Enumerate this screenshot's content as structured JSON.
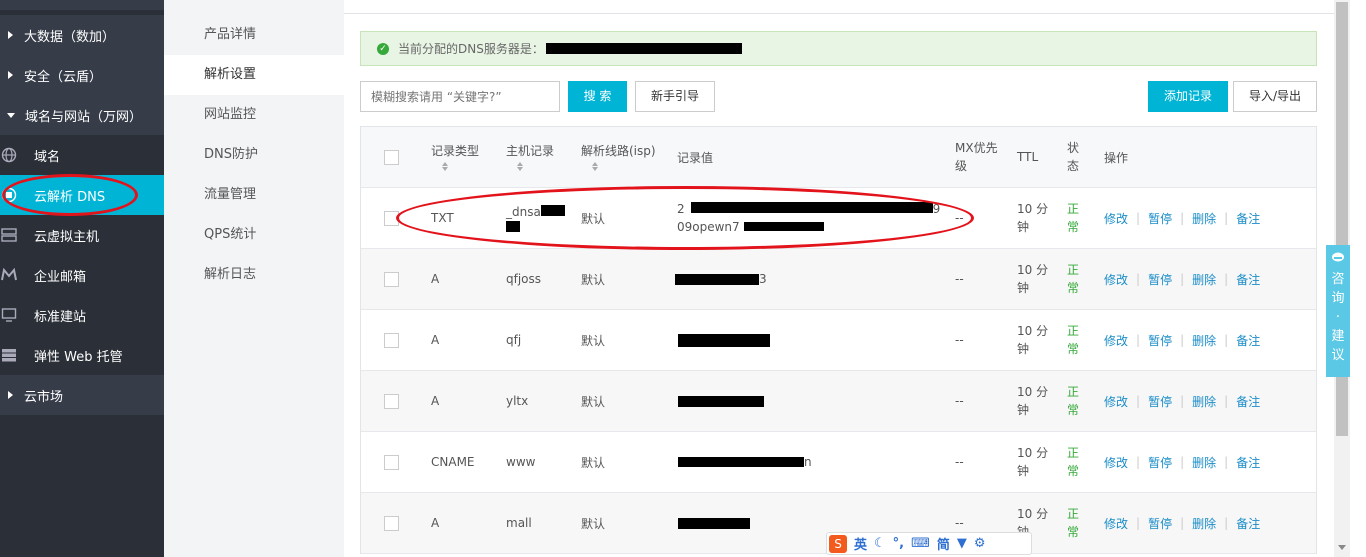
{
  "sidebar": {
    "groups": [
      {
        "label": "大数据（数加）"
      },
      {
        "label": "安全（云盾）"
      },
      {
        "label": "域名与网站（万网）"
      },
      {
        "label": "云市场"
      }
    ],
    "items": [
      {
        "label": "域名",
        "icon": "globe-icon"
      },
      {
        "label": "云解析 DNS",
        "icon": "dns-icon"
      },
      {
        "label": "云虚拟主机",
        "icon": "server-icon"
      },
      {
        "label": "企业邮箱",
        "icon": "mail-icon"
      },
      {
        "label": "标准建站",
        "icon": "monitor-icon"
      },
      {
        "label": "弹性 Web 托管",
        "icon": "hosting-icon"
      }
    ]
  },
  "subnav": {
    "items": [
      "产品详情",
      "解析设置",
      "网站监控",
      "DNS防护",
      "流量管理",
      "QPS统计",
      "解析日志"
    ]
  },
  "notice": {
    "text": "当前分配的DNS服务器是："
  },
  "toolbar": {
    "search_placeholder": "模糊搜索请用 “关键字?”",
    "search_label": "搜 索",
    "guide_label": "新手引导",
    "add_label": "添加记录",
    "import_label": "导入/导出"
  },
  "table": {
    "headers": {
      "type": "记录类型",
      "host": "主机记录",
      "line": "解析线路(isp)",
      "value": "记录值",
      "mx": "MX优先级",
      "ttl": "TTL",
      "status": "状态",
      "ops": "操作"
    },
    "rows": [
      {
        "type": "TXT",
        "host": "_dnsa",
        "line": "默认",
        "value_a": "2",
        "value_b": "09opewn7",
        "value_c": "9",
        "mx": "--",
        "ttl": "10 分钟",
        "status": "正常"
      },
      {
        "type": "A",
        "host": "qfjoss",
        "line": "默认",
        "value_a": "3",
        "mx": "--",
        "ttl": "10 分钟",
        "status": "正常"
      },
      {
        "type": "A",
        "host": "qfj",
        "line": "默认",
        "value_a": "",
        "mx": "--",
        "ttl": "10 分钟",
        "status": "正常"
      },
      {
        "type": "A",
        "host": "yltx",
        "line": "默认",
        "value_a": "",
        "mx": "--",
        "ttl": "10 分钟",
        "status": "正常"
      },
      {
        "type": "CNAME",
        "host": "www",
        "line": "默认",
        "value_a": "n",
        "mx": "--",
        "ttl": "10 分钟",
        "status": "正常"
      },
      {
        "type": "A",
        "host": "mall",
        "line": "默认",
        "value_a": "",
        "mx": "--",
        "ttl": "10 分钟",
        "status": "正常"
      }
    ],
    "ops": {
      "edit": "修改",
      "pause": "暂停",
      "delete": "删除",
      "note": "备注"
    }
  },
  "consult": {
    "chars": [
      "咨",
      "询",
      "·",
      "建",
      "议"
    ]
  },
  "ime": {
    "s": "S",
    "lang": "英",
    "simp": "简"
  }
}
